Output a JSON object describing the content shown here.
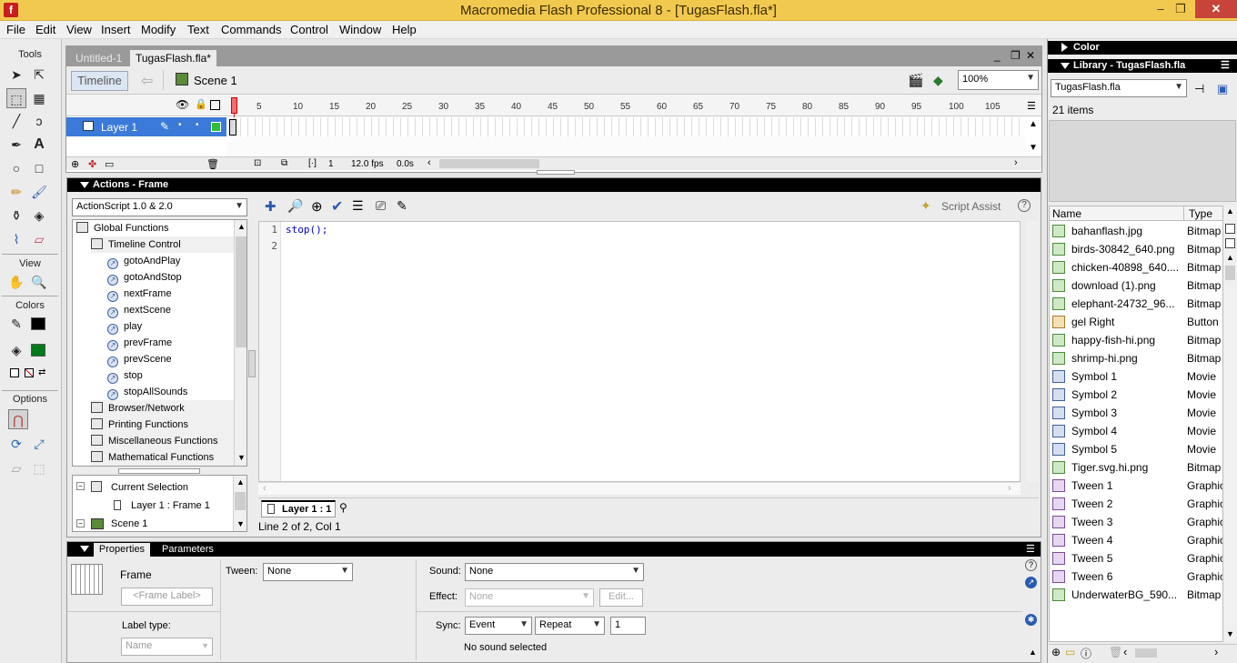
{
  "window": {
    "title": "Macromedia Flash Professional 8 - [TugasFlash.fla*]",
    "app_icon": "f",
    "minimize": "–",
    "restore": "❐",
    "close": "✕"
  },
  "menu": [
    "File",
    "Edit",
    "View",
    "Insert",
    "Modify",
    "Text",
    "Commands",
    "Control",
    "Window",
    "Help"
  ],
  "toolbox": {
    "tools_label": "Tools",
    "view_label": "View",
    "colors_label": "Colors",
    "options_label": "Options"
  },
  "document": {
    "tabs": [
      "Untitled-1",
      "TugasFlash.fla*"
    ],
    "timeline_button": "Timeline",
    "scene": "Scene 1",
    "zoom": "100%",
    "doc_controls": [
      "_",
      "❐",
      "✕"
    ]
  },
  "timeline": {
    "layer": "Layer 1",
    "ruler": [
      "5",
      "10",
      "15",
      "20",
      "25",
      "30",
      "35",
      "40",
      "45",
      "50",
      "55",
      "60",
      "65",
      "70",
      "75",
      "80",
      "85",
      "90",
      "95",
      "100",
      "105"
    ],
    "current_frame": "1",
    "fps": "12.0 fps",
    "time": "0.0s"
  },
  "actions": {
    "title": "Actions - Frame",
    "version_select": "ActionScript 1.0 & 2.0",
    "script_assist": "Script Assist",
    "help": "?",
    "tree": [
      "Global Functions",
      "Timeline Control",
      "gotoAndPlay",
      "gotoAndStop",
      "nextFrame",
      "nextScene",
      "play",
      "prevFrame",
      "prevScene",
      "stop",
      "stopAllSounds",
      "Browser/Network",
      "Printing Functions",
      "Miscellaneous Functions",
      "Mathematical Functions"
    ],
    "navigator": [
      "Current Selection",
      "Layer 1 : Frame 1",
      "Scene 1"
    ],
    "lines": [
      "1",
      "2"
    ],
    "code": "stop();",
    "script_tab": "Layer 1 : 1",
    "status": "Line 2 of 2, Col 1"
  },
  "properties": {
    "tabs": [
      "Properties",
      "Parameters"
    ],
    "frame_label": "Frame",
    "frame_placeholder": "<Frame Label>",
    "label_type": "Label type:",
    "label_type_value": "Name",
    "tween_label": "Tween:",
    "tween_value": "None",
    "sound_label": "Sound:",
    "sound_value": "None",
    "effect_label": "Effect:",
    "effect_value": "None",
    "edit_button": "Edit...",
    "sync_label": "Sync:",
    "sync_value": "Event",
    "repeat_value": "Repeat",
    "repeat_count": "1",
    "no_sound": "No sound selected",
    "help": "?"
  },
  "right": {
    "color_panel": "Color",
    "library_panel": "Library - TugasFlash.fla",
    "library_select": "TugasFlash.fla",
    "count": "21 items",
    "col_name": "Name",
    "col_type": "Type",
    "items": [
      {
        "name": "bahanflash.jpg",
        "type": "Bitmap",
        "icon": "bitmap-icon"
      },
      {
        "name": "birds-30842_640.png",
        "type": "Bitmap",
        "icon": "bitmap-icon"
      },
      {
        "name": "chicken-40898_640....",
        "type": "Bitmap",
        "icon": "bitmap-icon"
      },
      {
        "name": "download (1).png",
        "type": "Bitmap",
        "icon": "bitmap-icon"
      },
      {
        "name": "elephant-24732_96...",
        "type": "Bitmap",
        "icon": "bitmap-icon"
      },
      {
        "name": "gel Right",
        "type": "Button",
        "icon": "button-icon"
      },
      {
        "name": "happy-fish-hi.png",
        "type": "Bitmap",
        "icon": "bitmap-icon"
      },
      {
        "name": "shrimp-hi.png",
        "type": "Bitmap",
        "icon": "bitmap-icon"
      },
      {
        "name": "Symbol 1",
        "type": "Movie",
        "icon": "movie-clip-icon"
      },
      {
        "name": "Symbol 2",
        "type": "Movie",
        "icon": "movie-clip-icon"
      },
      {
        "name": "Symbol 3",
        "type": "Movie",
        "icon": "movie-clip-icon"
      },
      {
        "name": "Symbol 4",
        "type": "Movie",
        "icon": "movie-clip-icon"
      },
      {
        "name": "Symbol 5",
        "type": "Movie",
        "icon": "movie-clip-icon"
      },
      {
        "name": "Tiger.svg.hi.png",
        "type": "Bitmap",
        "icon": "bitmap-icon"
      },
      {
        "name": "Tween 1",
        "type": "Graphic",
        "icon": "graphic-icon"
      },
      {
        "name": "Tween 2",
        "type": "Graphic",
        "icon": "graphic-icon"
      },
      {
        "name": "Tween 3",
        "type": "Graphic",
        "icon": "graphic-icon"
      },
      {
        "name": "Tween 4",
        "type": "Graphic",
        "icon": "graphic-icon"
      },
      {
        "name": "Tween 5",
        "type": "Graphic",
        "icon": "graphic-icon"
      },
      {
        "name": "Tween 6",
        "type": "Graphic",
        "icon": "graphic-icon"
      },
      {
        "name": "UnderwaterBG_590...",
        "type": "Bitmap",
        "icon": "bitmap-icon"
      }
    ]
  },
  "colors": {
    "title_bar": "#f2c94f",
    "selection": "#3b7ad9",
    "panel_header": "#000000",
    "code_blue": "#0000cc"
  }
}
